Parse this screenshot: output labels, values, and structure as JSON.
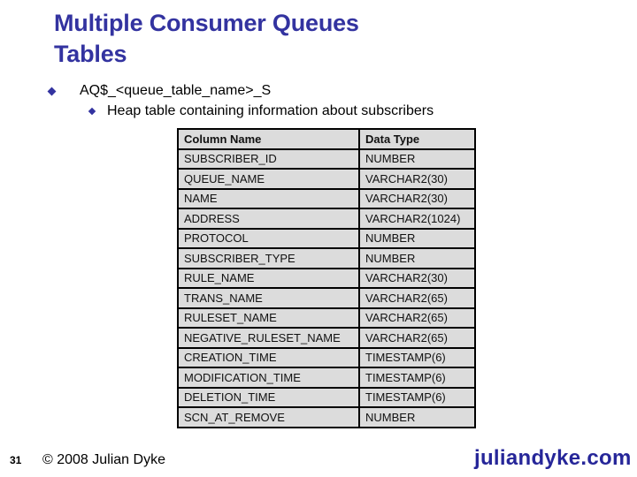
{
  "slide": {
    "title_line1": "Multiple Consumer Queues",
    "title_line2": "Tables",
    "bullets": [
      {
        "level": 1,
        "text": "AQ$_<queue_table_name>_S"
      },
      {
        "level": 2,
        "text": "Heap table containing information about subscribers"
      }
    ],
    "table": {
      "headers": [
        "Column Name",
        "Data Type"
      ],
      "rows": [
        [
          "SUBSCRIBER_ID",
          "NUMBER"
        ],
        [
          "QUEUE_NAME",
          "VARCHAR2(30)"
        ],
        [
          "NAME",
          "VARCHAR2(30)"
        ],
        [
          "ADDRESS",
          "VARCHAR2(1024)"
        ],
        [
          "PROTOCOL",
          "NUMBER"
        ],
        [
          "SUBSCRIBER_TYPE",
          "NUMBER"
        ],
        [
          "RULE_NAME",
          "VARCHAR2(30)"
        ],
        [
          "TRANS_NAME",
          "VARCHAR2(65)"
        ],
        [
          "RULESET_NAME",
          "VARCHAR2(65)"
        ],
        [
          "NEGATIVE_RULESET_NAME",
          "VARCHAR2(65)"
        ],
        [
          "CREATION_TIME",
          "TIMESTAMP(6)"
        ],
        [
          "MODIFICATION_TIME",
          "TIMESTAMP(6)"
        ],
        [
          "DELETION_TIME",
          "TIMESTAMP(6)"
        ],
        [
          "SCN_AT_REMOVE",
          "NUMBER"
        ]
      ]
    },
    "footer": {
      "page_number": "31",
      "copyright": "© 2008 Julian Dyke",
      "website": "juliandyke.com"
    },
    "colors": {
      "title": "#3333a0",
      "bullet": "#3333a0",
      "table_bg": "#dcdcdc",
      "website": "#262699"
    }
  }
}
